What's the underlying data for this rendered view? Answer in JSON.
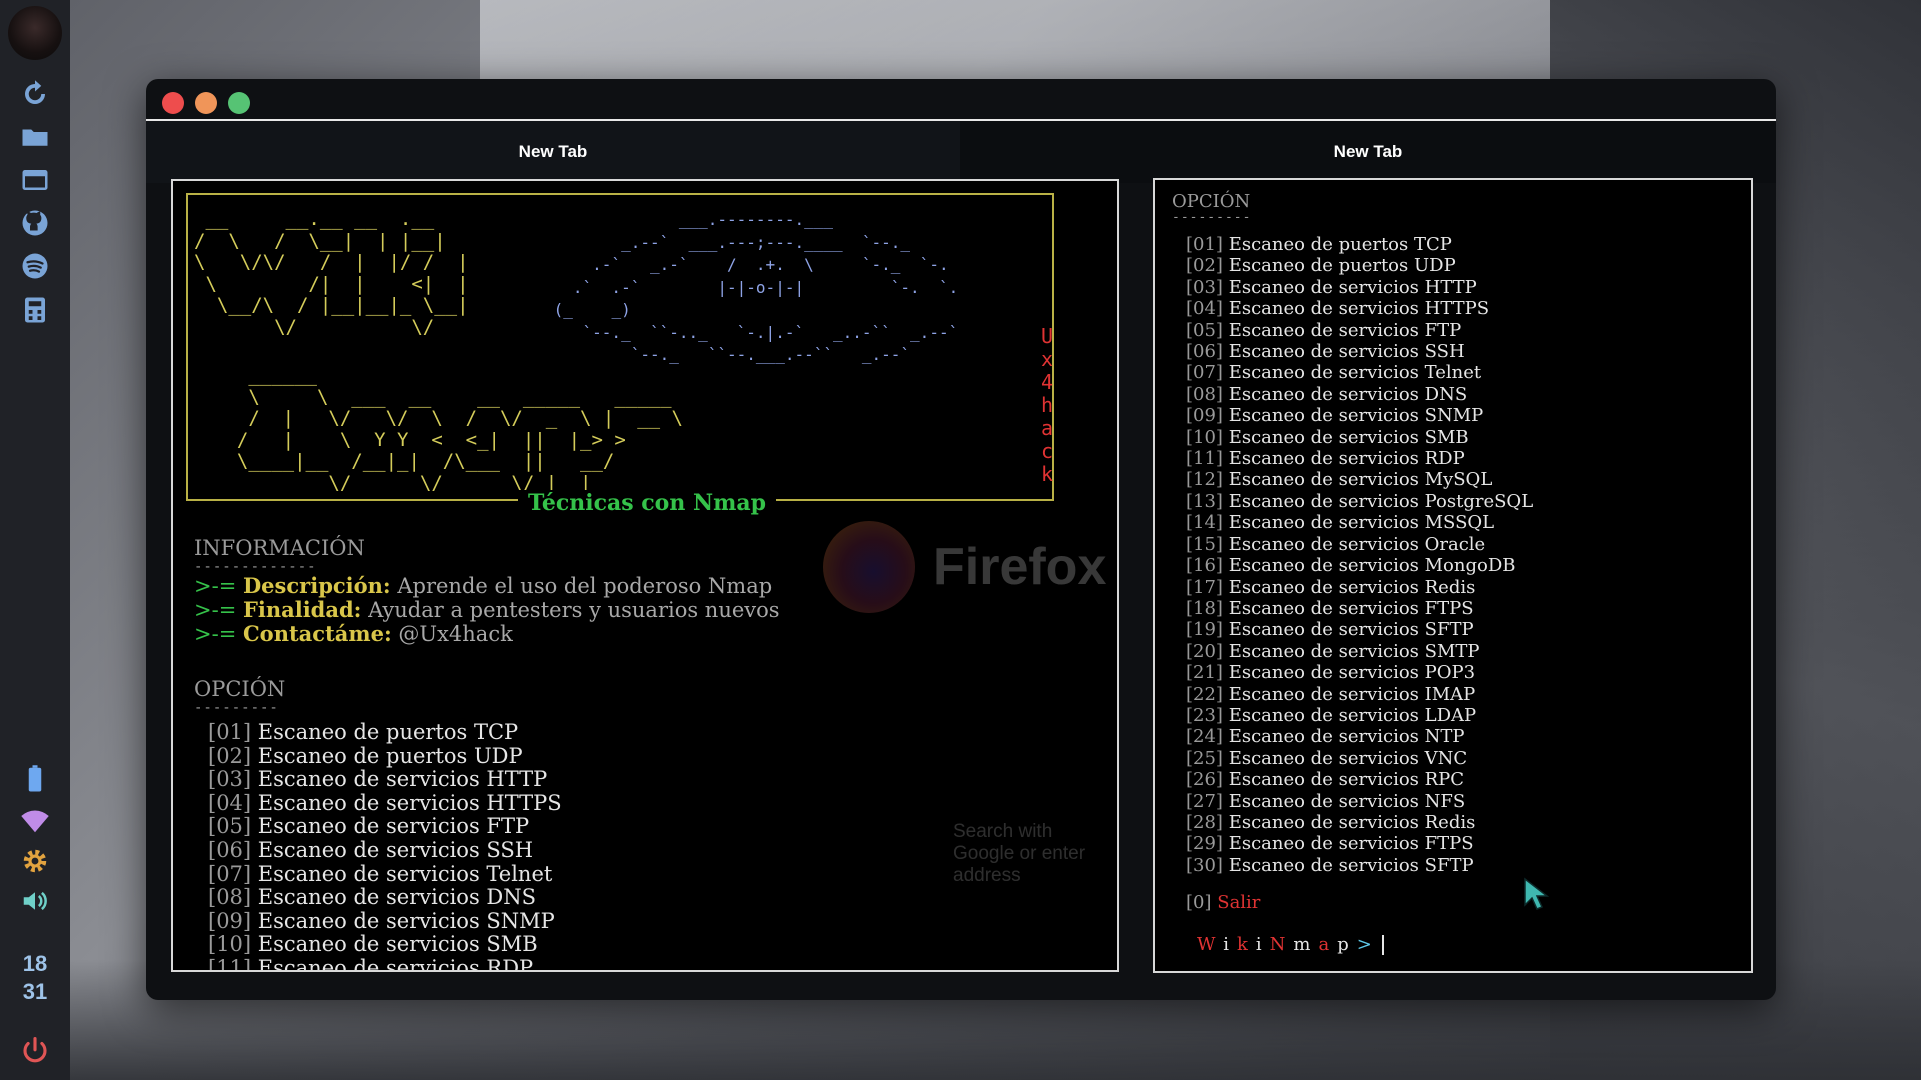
{
  "dock": {
    "icons": [
      "hooded-avatar",
      "refresh-icon",
      "folder-icon",
      "window-icon",
      "github-icon",
      "spotify-icon",
      "calculator-icon",
      "battery-icon",
      "wifi-icon",
      "gear-icon",
      "volume-icon",
      "power-icon"
    ],
    "clock_hour": "18",
    "clock_minute": "31"
  },
  "window": {
    "tabs": [
      "New Tab",
      "New Tab"
    ]
  },
  "banner": {
    "vertical_text": [
      "U",
      "x",
      "4",
      "h",
      "a",
      "c",
      "k"
    ],
    "title": "Técnicas con Nmap"
  },
  "background_app": {
    "name": "Firefox",
    "search_placeholder": "Search with Google or enter address"
  },
  "info": {
    "heading": "INFORMACIÓN",
    "rule": "-------------",
    "lines": [
      {
        "prefix": ">-= ",
        "key": "Descripción:",
        "value": " Aprende el uso del poderoso Nmap"
      },
      {
        "prefix": ">-= ",
        "key": "Finalidad:",
        "value": " Ayudar a pentesters y usuarios nuevos"
      },
      {
        "prefix": ">-= ",
        "key": "Contactáme:",
        "value": " @Ux4hack"
      }
    ]
  },
  "options_heading": "OPCIÓN",
  "options_rule": "---------",
  "options": [
    {
      "num": "[01]",
      "text": "Escaneo de puertos TCP"
    },
    {
      "num": "[02]",
      "text": "Escaneo de puertos UDP"
    },
    {
      "num": "[03]",
      "text": "Escaneo de servicios HTTP"
    },
    {
      "num": "[04]",
      "text": "Escaneo de servicios HTTPS"
    },
    {
      "num": "[05]",
      "text": "Escaneo de servicios FTP"
    },
    {
      "num": "[06]",
      "text": "Escaneo de servicios SSH"
    },
    {
      "num": "[07]",
      "text": "Escaneo de servicios Telnet"
    },
    {
      "num": "[08]",
      "text": "Escaneo de servicios DNS"
    },
    {
      "num": "[09]",
      "text": "Escaneo de servicios SNMP"
    },
    {
      "num": "[10]",
      "text": "Escaneo de servicios SMB"
    },
    {
      "num": "[11]",
      "text": "Escaneo de servicios RDP"
    },
    {
      "num": "[12]",
      "text": "Escaneo de servicios MySQL"
    },
    {
      "num": "[13]",
      "text": "Escaneo de servicios PostgreSQL"
    },
    {
      "num": "[14]",
      "text": "Escaneo de servicios MSSQL"
    },
    {
      "num": "[15]",
      "text": "Escaneo de servicios Oracle"
    },
    {
      "num": "[16]",
      "text": "Escaneo de servicios MongoDB"
    },
    {
      "num": "[17]",
      "text": "Escaneo de servicios Redis"
    },
    {
      "num": "[18]",
      "text": "Escaneo de servicios FTPS"
    },
    {
      "num": "[19]",
      "text": "Escaneo de servicios SFTP"
    },
    {
      "num": "[20]",
      "text": "Escaneo de servicios SMTP"
    },
    {
      "num": "[21]",
      "text": "Escaneo de servicios POP3"
    },
    {
      "num": "[22]",
      "text": "Escaneo de servicios IMAP"
    },
    {
      "num": "[23]",
      "text": "Escaneo de servicios LDAP"
    },
    {
      "num": "[24]",
      "text": "Escaneo de servicios NTP"
    },
    {
      "num": "[25]",
      "text": "Escaneo de servicios VNC"
    },
    {
      "num": "[26]",
      "text": "Escaneo de servicios RPC"
    },
    {
      "num": "[27]",
      "text": "Escaneo de servicios NFS"
    },
    {
      "num": "[28]",
      "text": "Escaneo de servicios Redis"
    },
    {
      "num": "[29]",
      "text": "Escaneo de servicios FTPS"
    },
    {
      "num": "[30]",
      "text": "Escaneo de servicios SFTP"
    }
  ],
  "left_pane_visible_options": 11,
  "exit": {
    "num": "[0]",
    "label": "Salir"
  },
  "prompt": {
    "chars": [
      {
        "c": "W",
        "color": "red"
      },
      {
        "c": "i",
        "color": "white"
      },
      {
        "c": "k",
        "color": "red"
      },
      {
        "c": "i",
        "color": "white"
      },
      {
        "c": "N",
        "color": "red"
      },
      {
        "c": "m",
        "color": "white"
      },
      {
        "c": "a",
        "color": "red"
      },
      {
        "c": "p",
        "color": "white"
      },
      {
        "c": ">",
        "color": "cyan"
      }
    ]
  },
  "colors": {
    "banner_border": "#b9b146",
    "ascii_yellow": "#d4cc5a",
    "ascii_blue": "#8ea3e6",
    "title_green": "#35c24a",
    "accent_red": "#e03333",
    "key_yellow": "#d9c64a"
  }
}
